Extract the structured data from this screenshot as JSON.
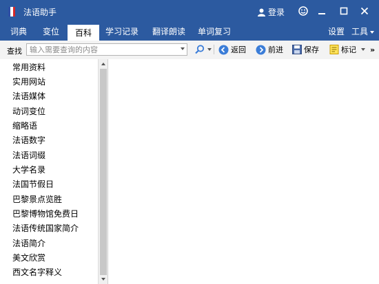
{
  "window": {
    "title": "法语助手",
    "login_label": "登录"
  },
  "menu": {
    "tabs": [
      {
        "label": "词典"
      },
      {
        "label": "变位"
      },
      {
        "label": "百科",
        "active": true
      },
      {
        "label": "学习记录"
      },
      {
        "label": "翻译朗读"
      },
      {
        "label": "单词复习"
      }
    ],
    "settings_label": "设置",
    "tools_label": "工具"
  },
  "toolbar": {
    "find_label": "查找",
    "search_placeholder": "输入需要查询的内容",
    "search_value": "",
    "back_label": "返回",
    "forward_label": "前进",
    "save_label": "保存",
    "mark_label": "标记",
    "overflow_label": "»"
  },
  "sidebar": {
    "items": [
      "常用资料",
      "实用网站",
      "法语媒体",
      "动词变位",
      "缩略语",
      "法语数字",
      "法语词缀",
      "大学名录",
      "法国节假日",
      "巴黎景点览胜",
      "巴黎博物馆免费日",
      "法语传统国家简介",
      "法语简介",
      "美文欣赏",
      "西文名字释义"
    ]
  },
  "colors": {
    "titlebar": "#2c5aa0",
    "tool_icon_blue": "#3b7dd8",
    "save_icon": "#4a6aa8",
    "mark_icon": "#e8b400"
  },
  "icons": [
    "french-flag-icon",
    "user-icon",
    "smiley-icon",
    "minimize-icon",
    "maximize-icon",
    "close-icon",
    "search-icon",
    "back-icon",
    "forward-icon",
    "save-icon",
    "mark-icon",
    "chevron-down-icon"
  ]
}
